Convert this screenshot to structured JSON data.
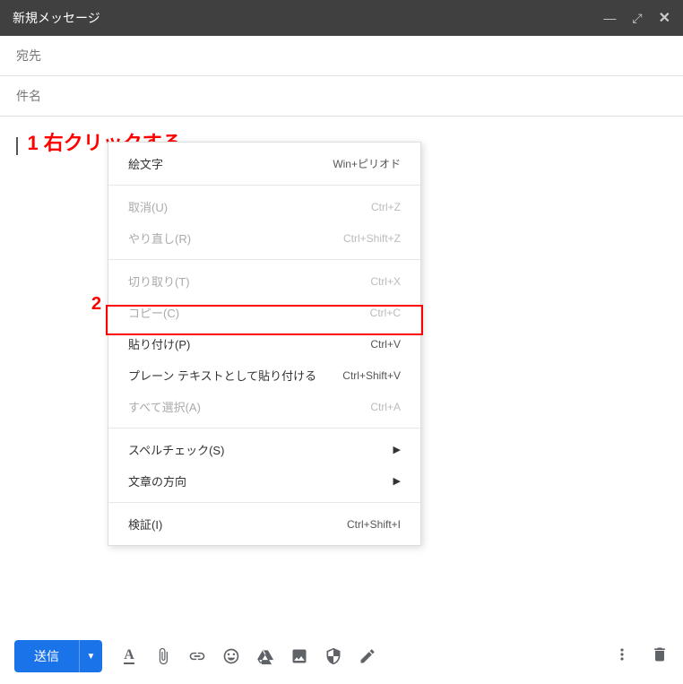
{
  "header": {
    "title": "新規メッセージ"
  },
  "fields": {
    "to_label": "宛先",
    "subject_label": "件名"
  },
  "annotations": {
    "a1": "1 右クリックする",
    "a2": "2"
  },
  "context_menu": {
    "groups": [
      [
        {
          "label": "絵文字",
          "shortcut": "Win+ピリオド",
          "disabled": false
        }
      ],
      [
        {
          "label": "取消(U)",
          "shortcut": "Ctrl+Z",
          "disabled": true
        },
        {
          "label": "やり直し(R)",
          "shortcut": "Ctrl+Shift+Z",
          "disabled": true
        }
      ],
      [
        {
          "label": "切り取り(T)",
          "shortcut": "Ctrl+X",
          "disabled": true
        },
        {
          "label": "コピー(C)",
          "shortcut": "Ctrl+C",
          "disabled": true
        },
        {
          "label": "貼り付け(P)",
          "shortcut": "Ctrl+V",
          "disabled": false,
          "highlight": true
        },
        {
          "label": "プレーン テキストとして貼り付ける",
          "shortcut": "Ctrl+Shift+V",
          "disabled": false
        },
        {
          "label": "すべて選択(A)",
          "shortcut": "Ctrl+A",
          "disabled": true
        }
      ],
      [
        {
          "label": "スペルチェック(S)",
          "submenu": true,
          "disabled": false
        },
        {
          "label": "文章の方向",
          "submenu": true,
          "disabled": false
        }
      ],
      [
        {
          "label": "検証(I)",
          "shortcut": "Ctrl+Shift+I",
          "disabled": false
        }
      ]
    ]
  },
  "toolbar": {
    "send_label": "送信"
  }
}
